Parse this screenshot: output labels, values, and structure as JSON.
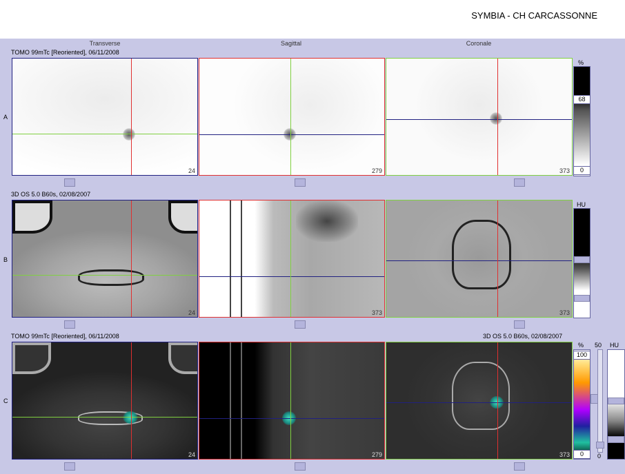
{
  "header": {
    "hospital": "SYMBIA - CH CARCASSONNE"
  },
  "columns": {
    "transverse": "Transverse",
    "sagittal": "Sagittal",
    "coronal": "Coronale"
  },
  "rows": {
    "a": {
      "letter": "A",
      "study": "TOMO 99mTc [Reoriented], 06/11/2008"
    },
    "b": {
      "letter": "B",
      "study": "3D  OS  5.0  B60s, 02/08/2007"
    },
    "c": {
      "letter": "C",
      "study_left": "TOMO 99mTc [Reoriented], 06/11/2008",
      "study_right": "3D  OS  5.0  B60s, 02/08/2007"
    }
  },
  "slices": {
    "a": [
      "24",
      "279",
      "373"
    ],
    "b": [
      "24",
      "373",
      "373"
    ],
    "c": [
      "24",
      "279",
      "373"
    ]
  },
  "scales": {
    "a": {
      "unit": "%",
      "max": "68",
      "min": "0"
    },
    "b": {
      "unit": "HU"
    },
    "c": {
      "unit_pct": "%",
      "max_pct": "100",
      "min_pct": "0",
      "unit_hu": "HU",
      "blend": "50",
      "blend_min": "0"
    }
  },
  "colors": {
    "background": "#c8c8e6",
    "crosshair_red": "#e03030",
    "crosshair_green": "#80d040",
    "crosshair_blue": "#202080"
  }
}
